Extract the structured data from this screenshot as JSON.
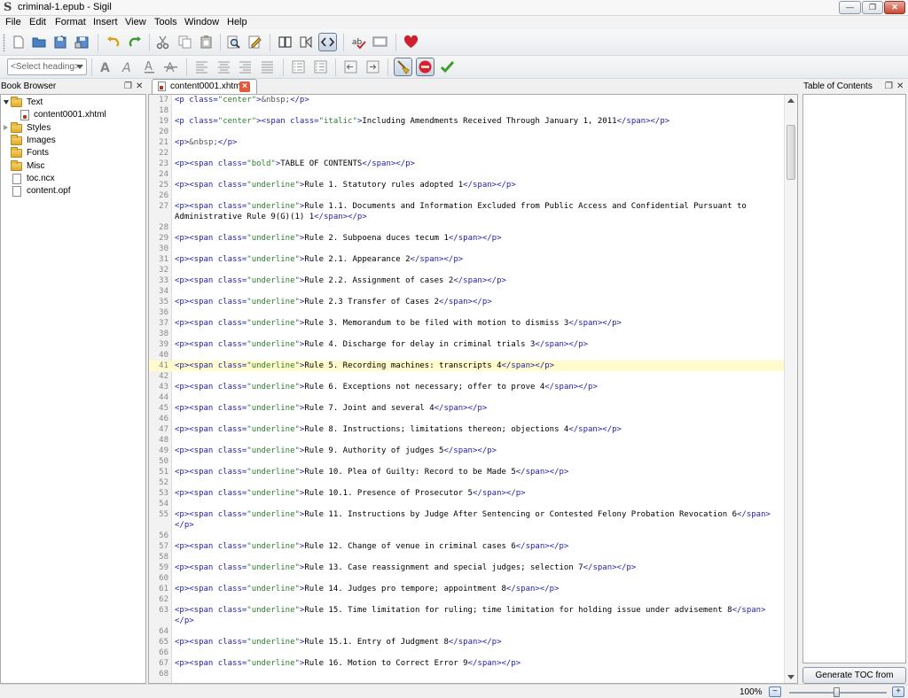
{
  "window": {
    "title": "criminal-1.epub - Sigil",
    "app_logo": "S",
    "buttons": [
      "—",
      "❐",
      "✕"
    ]
  },
  "menu": [
    "File",
    "Edit",
    "Format",
    "Insert",
    "View",
    "Tools",
    "Window",
    "Help"
  ],
  "toolbar": {
    "heading_select": "<Select heading>"
  },
  "book_browser": {
    "title": "Book Browser",
    "items": [
      {
        "label": "Text",
        "type": "folder",
        "expanded": true,
        "level": 0
      },
      {
        "label": "content0001.xhtml",
        "type": "file",
        "level": 1
      },
      {
        "label": "Styles",
        "type": "folder",
        "expanded": false,
        "level": 0
      },
      {
        "label": "Images",
        "type": "folder",
        "level": 0
      },
      {
        "label": "Fonts",
        "type": "folder",
        "level": 0
      },
      {
        "label": "Misc",
        "type": "folder",
        "level": 0
      },
      {
        "label": "toc.ncx",
        "type": "file",
        "level": 0
      },
      {
        "label": "content.opf",
        "type": "file",
        "level": 0
      }
    ]
  },
  "editor": {
    "tab_label": "content0001.xhtml",
    "highlight_line": 41,
    "lines": [
      {
        "n": 17,
        "kind": "center_nbsp"
      },
      {
        "n": 18,
        "kind": "blank"
      },
      {
        "n": 19,
        "kind": "center_italic",
        "text": "Including Amendments Received Through January 1, 2011"
      },
      {
        "n": 20,
        "kind": "blank"
      },
      {
        "n": 21,
        "kind": "p_nbsp"
      },
      {
        "n": 22,
        "kind": "blank"
      },
      {
        "n": 23,
        "kind": "span",
        "cls": "bold",
        "text": "TABLE OF CONTENTS"
      },
      {
        "n": 24,
        "kind": "blank"
      },
      {
        "n": 25,
        "kind": "span",
        "cls": "underline",
        "text": "Rule 1. Statutory rules adopted 1"
      },
      {
        "n": 26,
        "kind": "blank"
      },
      {
        "n": 27,
        "kind": "span",
        "cls": "underline",
        "text": "Rule 1.1. Documents and Information Excluded from Public Access and Confidential Pursuant to Administrative Rule 9(G)(1) 1"
      },
      {
        "n": 28,
        "kind": "blank"
      },
      {
        "n": 29,
        "kind": "span",
        "cls": "underline",
        "text": "Rule 2. Subpoena duces tecum 1"
      },
      {
        "n": 30,
        "kind": "blank"
      },
      {
        "n": 31,
        "kind": "span",
        "cls": "underline",
        "text": "Rule 2.1. Appearance 2"
      },
      {
        "n": 32,
        "kind": "blank"
      },
      {
        "n": 33,
        "kind": "span",
        "cls": "underline",
        "text": "Rule 2.2. Assignment of cases 2"
      },
      {
        "n": 34,
        "kind": "blank"
      },
      {
        "n": 35,
        "kind": "span",
        "cls": "underline",
        "text": "Rule 2.3 Transfer of Cases 2"
      },
      {
        "n": 36,
        "kind": "blank"
      },
      {
        "n": 37,
        "kind": "span",
        "cls": "underline",
        "text": "Rule 3. Memorandum to be filed with motion to dismiss 3"
      },
      {
        "n": 38,
        "kind": "blank"
      },
      {
        "n": 39,
        "kind": "span",
        "cls": "underline",
        "text": "Rule 4. Discharge for delay in criminal trials 3"
      },
      {
        "n": 40,
        "kind": "blank"
      },
      {
        "n": 41,
        "kind": "span",
        "cls": "underline",
        "text": "Rule 5. Recording machines: transcripts 4"
      },
      {
        "n": 42,
        "kind": "blank"
      },
      {
        "n": 43,
        "kind": "span",
        "cls": "underline",
        "text": "Rule 6. Exceptions not necessary; offer to prove 4"
      },
      {
        "n": 44,
        "kind": "blank"
      },
      {
        "n": 45,
        "kind": "span",
        "cls": "underline",
        "text": "Rule 7. Joint and several 4"
      },
      {
        "n": 46,
        "kind": "blank"
      },
      {
        "n": 47,
        "kind": "span",
        "cls": "underline",
        "text": "Rule 8. Instructions; limitations thereon; objections 4"
      },
      {
        "n": 48,
        "kind": "blank"
      },
      {
        "n": 49,
        "kind": "span",
        "cls": "underline",
        "text": "Rule 9. Authority of judges 5"
      },
      {
        "n": 50,
        "kind": "blank"
      },
      {
        "n": 51,
        "kind": "span",
        "cls": "underline",
        "text": "Rule 10. Plea of Guilty: Record to be Made 5"
      },
      {
        "n": 52,
        "kind": "blank"
      },
      {
        "n": 53,
        "kind": "span",
        "cls": "underline",
        "text": "Rule 10.1. Presence of Prosecutor 5"
      },
      {
        "n": 54,
        "kind": "blank"
      },
      {
        "n": 55,
        "kind": "span",
        "cls": "underline",
        "text": "Rule 11. Instructions by Judge After Sentencing or Contested Felony Probation Revocation 6"
      },
      {
        "n": 56,
        "kind": "blank"
      },
      {
        "n": 57,
        "kind": "span",
        "cls": "underline",
        "text": "Rule 12. Change of venue in criminal cases 6"
      },
      {
        "n": 58,
        "kind": "blank"
      },
      {
        "n": 59,
        "kind": "span",
        "cls": "underline",
        "text": "Rule 13. Case reassignment and special judges; selection 7"
      },
      {
        "n": 60,
        "kind": "blank"
      },
      {
        "n": 61,
        "kind": "span",
        "cls": "underline",
        "text": "Rule 14. Judges pro tempore; appointment 8"
      },
      {
        "n": 62,
        "kind": "blank"
      },
      {
        "n": 63,
        "kind": "span",
        "cls": "underline",
        "text": "Rule 15. Time limitation for ruling; time limitation for holding issue under advisement 8"
      },
      {
        "n": 64,
        "kind": "blank"
      },
      {
        "n": 65,
        "kind": "span",
        "cls": "underline",
        "text": "Rule 15.1. Entry of Judgment 8"
      },
      {
        "n": 66,
        "kind": "blank"
      },
      {
        "n": 67,
        "kind": "span",
        "cls": "underline",
        "text": "Rule 16. Motion to Correct Error 9"
      },
      {
        "n": 68,
        "kind": "blank"
      }
    ]
  },
  "toc_panel": {
    "title": "Table of Contents",
    "generate_button": "Generate TOC from headings"
  },
  "status": {
    "zoom": "100%",
    "zoom_minus": "−",
    "zoom_plus": "+"
  },
  "colors": {
    "tag": "#1f1fa8",
    "value": "#2c7c2c",
    "highlight": "#fffbcc",
    "accent": "#cf2030"
  }
}
